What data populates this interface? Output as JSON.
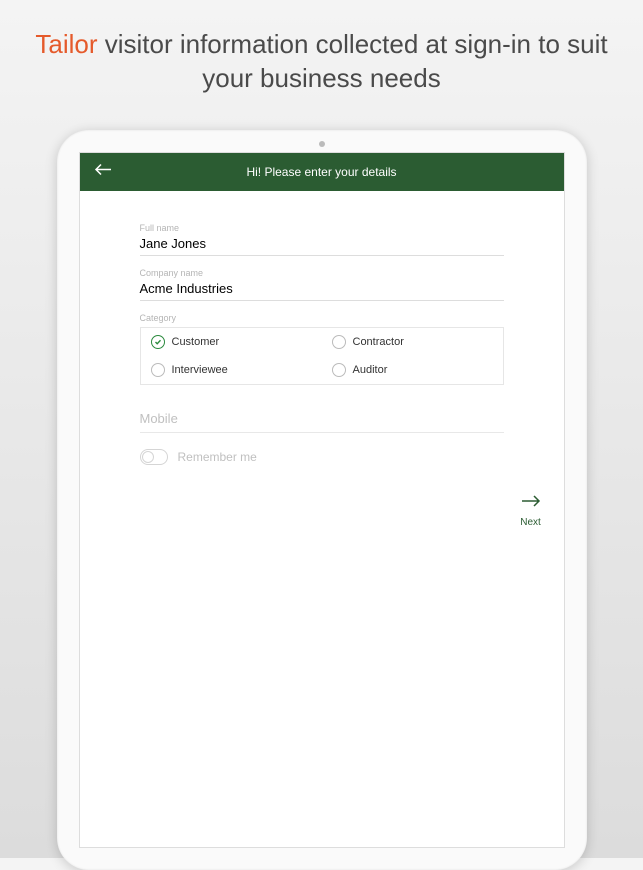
{
  "marketing": {
    "accent": "Tailor",
    "rest": " visitor information collected at sign-in to suit your business needs"
  },
  "header": {
    "title": "Hi! Please enter your details"
  },
  "form": {
    "full_name_label": "Full name",
    "full_name_value": "Jane Jones",
    "company_label": "Company name",
    "company_value": "Acme Industries",
    "category_label": "Category",
    "categories": {
      "customer": "Customer",
      "contractor": "Contractor",
      "interviewee": "Interviewee",
      "auditor": "Auditor"
    },
    "selected_category": "customer",
    "mobile_placeholder": "Mobile",
    "remember_label": "Remember me"
  },
  "next_label": "Next"
}
